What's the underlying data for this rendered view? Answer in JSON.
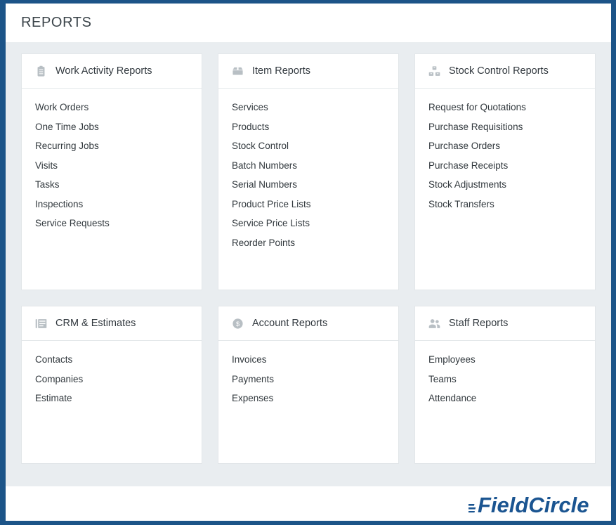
{
  "header": {
    "title": "REPORTS"
  },
  "footer": {
    "brand": "FieldCircle",
    "brand_color": "#1b5591"
  },
  "theme": {
    "frame_border": "#1c5488",
    "body_background": "#e9edf0",
    "card_background": "#ffffff",
    "card_border": "#e2e6e9",
    "title_color": "#3b444a",
    "list_text_color": "#31383d",
    "icon_color": "#b8bfc4"
  },
  "cards": [
    {
      "icon": "clipboard-icon",
      "title": "Work Activity Reports",
      "items": [
        "Work Orders",
        "One Time Jobs",
        "Recurring Jobs",
        "Visits",
        "Tasks",
        "Inspections",
        "Service Requests"
      ]
    },
    {
      "icon": "box-icon",
      "title": "Item Reports",
      "items": [
        "Services",
        "Products",
        "Stock Control",
        "Batch Numbers",
        "Serial Numbers",
        "Product Price Lists",
        "Service Price Lists",
        "Reorder Points"
      ]
    },
    {
      "icon": "stacked-boxes-icon",
      "title": "Stock Control Reports",
      "items": [
        "Request for Quotations",
        "Purchase Requisitions",
        "Purchase Orders",
        "Purchase Receipts",
        "Stock Adjustments",
        "Stock Transfers"
      ]
    },
    {
      "icon": "list-card-icon",
      "title": "CRM & Estimates",
      "items": [
        "Contacts",
        "Companies",
        "Estimate"
      ]
    },
    {
      "icon": "dollar-circle-icon",
      "title": "Account Reports",
      "items": [
        "Invoices",
        "Payments",
        "Expenses"
      ]
    },
    {
      "icon": "people-icon",
      "title": "Staff Reports",
      "items": [
        "Employees",
        "Teams",
        "Attendance"
      ]
    }
  ]
}
